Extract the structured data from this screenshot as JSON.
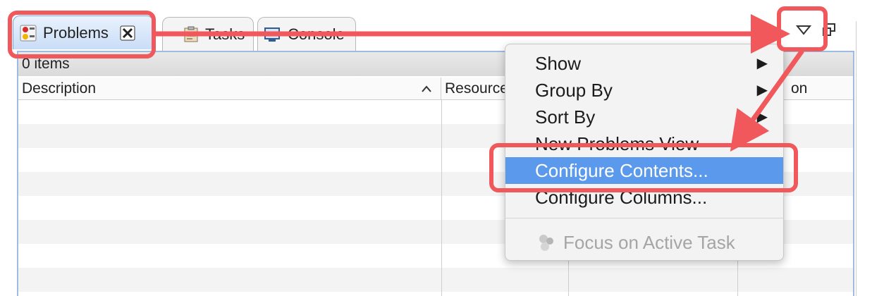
{
  "tabs": [
    {
      "label": "Problems",
      "icon": "problems-icon",
      "active": true
    },
    {
      "label": "Tasks",
      "icon": "tasks-icon"
    },
    {
      "label": "Console",
      "icon": "console-icon"
    }
  ],
  "status_text": "0 items",
  "table": {
    "columns": [
      "Description",
      "Resource",
      "",
      "on"
    ]
  },
  "menu": {
    "items": [
      {
        "label": "Show",
        "submenu": true
      },
      {
        "label": "Group By",
        "submenu": true
      },
      {
        "label": "Sort By",
        "submenu": true
      },
      {
        "label": "New Problems View"
      },
      {
        "label": "Configure Contents...",
        "selected": true
      },
      {
        "label": "Configure Columns..."
      },
      {
        "label": "Focus on Active Task",
        "disabled": true
      }
    ]
  },
  "colors": {
    "annotation": "#f0585b",
    "selection": "#5b99ed",
    "active_tab_border": "#7da6d9"
  }
}
